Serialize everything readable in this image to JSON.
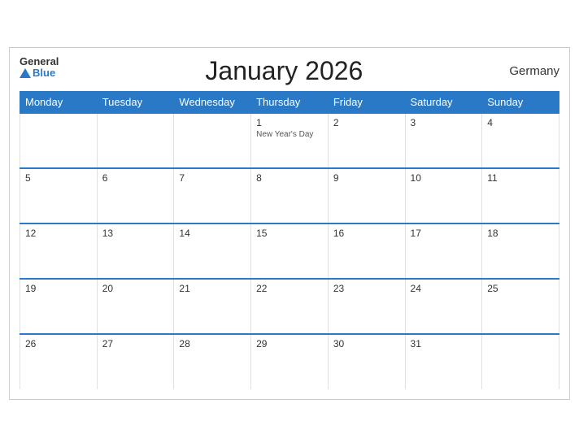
{
  "header": {
    "title": "January 2026",
    "country": "Germany",
    "logo_general": "General",
    "logo_blue": "Blue"
  },
  "weekdays": [
    "Monday",
    "Tuesday",
    "Wednesday",
    "Thursday",
    "Friday",
    "Saturday",
    "Sunday"
  ],
  "weeks": [
    [
      {
        "day": "",
        "event": ""
      },
      {
        "day": "",
        "event": ""
      },
      {
        "day": "",
        "event": ""
      },
      {
        "day": "1",
        "event": "New Year's Day"
      },
      {
        "day": "2",
        "event": ""
      },
      {
        "day": "3",
        "event": ""
      },
      {
        "day": "4",
        "event": ""
      }
    ],
    [
      {
        "day": "5",
        "event": ""
      },
      {
        "day": "6",
        "event": ""
      },
      {
        "day": "7",
        "event": ""
      },
      {
        "day": "8",
        "event": ""
      },
      {
        "day": "9",
        "event": ""
      },
      {
        "day": "10",
        "event": ""
      },
      {
        "day": "11",
        "event": ""
      }
    ],
    [
      {
        "day": "12",
        "event": ""
      },
      {
        "day": "13",
        "event": ""
      },
      {
        "day": "14",
        "event": ""
      },
      {
        "day": "15",
        "event": ""
      },
      {
        "day": "16",
        "event": ""
      },
      {
        "day": "17",
        "event": ""
      },
      {
        "day": "18",
        "event": ""
      }
    ],
    [
      {
        "day": "19",
        "event": ""
      },
      {
        "day": "20",
        "event": ""
      },
      {
        "day": "21",
        "event": ""
      },
      {
        "day": "22",
        "event": ""
      },
      {
        "day": "23",
        "event": ""
      },
      {
        "day": "24",
        "event": ""
      },
      {
        "day": "25",
        "event": ""
      }
    ],
    [
      {
        "day": "26",
        "event": ""
      },
      {
        "day": "27",
        "event": ""
      },
      {
        "day": "28",
        "event": ""
      },
      {
        "day": "29",
        "event": ""
      },
      {
        "day": "30",
        "event": ""
      },
      {
        "day": "31",
        "event": ""
      },
      {
        "day": "",
        "event": ""
      }
    ]
  ]
}
